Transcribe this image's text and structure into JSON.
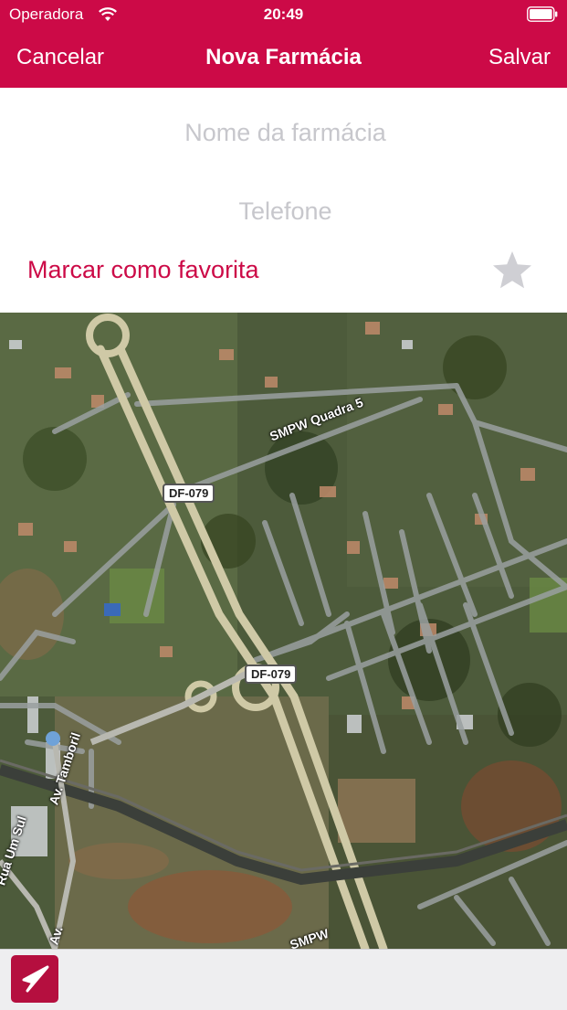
{
  "status_bar": {
    "carrier": "Operadora",
    "time": "20:49"
  },
  "nav": {
    "cancel_label": "Cancelar",
    "title": "Nova Farmácia",
    "save_label": "Salvar"
  },
  "form": {
    "name_placeholder": "Nome da farmácia",
    "phone_placeholder": "Telefone",
    "favorite_label": "Marcar como favorita",
    "favorite_icon": "star-icon",
    "favorite_checked": false
  },
  "map": {
    "road_labels": [
      "DF-079",
      "DF-079"
    ],
    "street_labels": [
      "SMPW Quadra 5",
      "Av. Tamboril",
      "Rua Um Sul",
      "SMPW",
      "Av."
    ]
  },
  "toolbar": {
    "locate_icon": "location-arrow-icon"
  },
  "colors": {
    "brand": "#cc0a47",
    "placeholder": "#c7c7cc",
    "toolbar_bg": "#eeeef0"
  }
}
